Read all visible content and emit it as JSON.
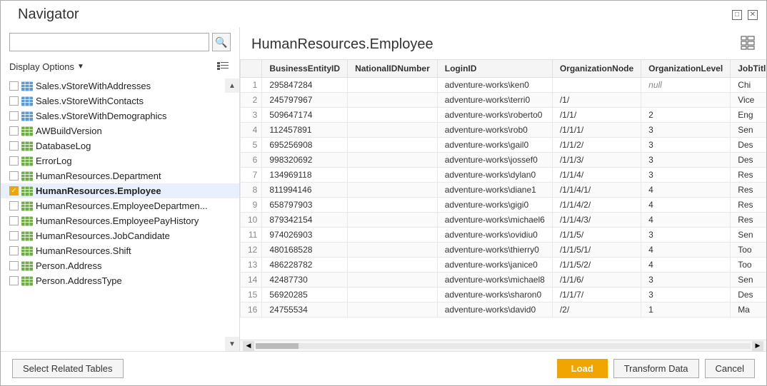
{
  "window": {
    "title": "Navigator"
  },
  "search": {
    "placeholder": "",
    "value": ""
  },
  "display_options": {
    "label": "Display Options",
    "chevron": "▼"
  },
  "nav_items": [
    {
      "id": "salesStoreWithAddresses",
      "label": "Sales.vStoreWithAddresses",
      "checked": false,
      "type": "view"
    },
    {
      "id": "salesStoreWithContacts",
      "label": "Sales.vStoreWithContacts",
      "checked": false,
      "type": "view"
    },
    {
      "id": "salesStoreWithDemographics",
      "label": "Sales.vStoreWithDemographics",
      "checked": false,
      "type": "view"
    },
    {
      "id": "awBuildVersion",
      "label": "AWBuildVersion",
      "checked": false,
      "type": "table"
    },
    {
      "id": "databaseLog",
      "label": "DatabaseLog",
      "checked": false,
      "type": "table"
    },
    {
      "id": "errorLog",
      "label": "ErrorLog",
      "checked": false,
      "type": "table"
    },
    {
      "id": "hrDepartment",
      "label": "HumanResources.Department",
      "checked": false,
      "type": "table"
    },
    {
      "id": "hrEmployee",
      "label": "HumanResources.Employee",
      "checked": true,
      "type": "table",
      "selected": true
    },
    {
      "id": "hrEmployeeDepartment",
      "label": "HumanResources.EmployeeDepartmen...",
      "checked": false,
      "type": "table"
    },
    {
      "id": "hrEmployeePayHistory",
      "label": "HumanResources.EmployeePayHistory",
      "checked": false,
      "type": "table"
    },
    {
      "id": "hrJobCandidate",
      "label": "HumanResources.JobCandidate",
      "checked": false,
      "type": "table"
    },
    {
      "id": "hrShift",
      "label": "HumanResources.Shift",
      "checked": false,
      "type": "table"
    },
    {
      "id": "personAddress",
      "label": "Person.Address",
      "checked": false,
      "type": "table"
    },
    {
      "id": "personAddressType",
      "label": "Person.AddressType",
      "checked": false,
      "type": "table"
    }
  ],
  "preview": {
    "title": "HumanResources.Employee",
    "columns": [
      "BusinessEntityID",
      "NationalIDNumber",
      "LoginID",
      "OrganizationNode",
      "OrganizationLevel",
      "JobTitl"
    ],
    "rows": [
      {
        "num": "1",
        "BusinessEntityID": "295847284",
        "NationalIDNumber": "",
        "LoginID": "adventure-works\\ken0",
        "OrganizationNode": "",
        "OrganizationLevel": "null",
        "JobTitle": "Chi"
      },
      {
        "num": "2",
        "BusinessEntityID": "245797967",
        "NationalIDNumber": "",
        "LoginID": "adventure-works\\terri0",
        "OrganizationNode": "/1/",
        "OrganizationLevel": "",
        "JobTitle": "Vice"
      },
      {
        "num": "3",
        "BusinessEntityID": "509647174",
        "NationalIDNumber": "",
        "LoginID": "adventure-works\\roberto0",
        "OrganizationNode": "/1/1/",
        "OrganizationLevel": "2",
        "JobTitle": "Eng"
      },
      {
        "num": "4",
        "BusinessEntityID": "112457891",
        "NationalIDNumber": "",
        "LoginID": "adventure-works\\rob0",
        "OrganizationNode": "/1/1/1/",
        "OrganizationLevel": "3",
        "JobTitle": "Sen"
      },
      {
        "num": "5",
        "BusinessEntityID": "695256908",
        "NationalIDNumber": "",
        "LoginID": "adventure-works\\gail0",
        "OrganizationNode": "/1/1/2/",
        "OrganizationLevel": "3",
        "JobTitle": "Des"
      },
      {
        "num": "6",
        "BusinessEntityID": "998320692",
        "NationalIDNumber": "",
        "LoginID": "adventure-works\\jossef0",
        "OrganizationNode": "/1/1/3/",
        "OrganizationLevel": "3",
        "JobTitle": "Des"
      },
      {
        "num": "7",
        "BusinessEntityID": "134969118",
        "NationalIDNumber": "",
        "LoginID": "adventure-works\\dylan0",
        "OrganizationNode": "/1/1/4/",
        "OrganizationLevel": "3",
        "JobTitle": "Res"
      },
      {
        "num": "8",
        "BusinessEntityID": "811994146",
        "NationalIDNumber": "",
        "LoginID": "adventure-works\\diane1",
        "OrganizationNode": "/1/1/4/1/",
        "OrganizationLevel": "4",
        "JobTitle": "Res"
      },
      {
        "num": "9",
        "BusinessEntityID": "658797903",
        "NationalIDNumber": "",
        "LoginID": "adventure-works\\gigi0",
        "OrganizationNode": "/1/1/4/2/",
        "OrganizationLevel": "4",
        "JobTitle": "Res"
      },
      {
        "num": "10",
        "BusinessEntityID": "879342154",
        "NationalIDNumber": "",
        "LoginID": "adventure-works\\michael6",
        "OrganizationNode": "/1/1/4/3/",
        "OrganizationLevel": "4",
        "JobTitle": "Res"
      },
      {
        "num": "11",
        "BusinessEntityID": "974026903",
        "NationalIDNumber": "",
        "LoginID": "adventure-works\\ovidiu0",
        "OrganizationNode": "/1/1/5/",
        "OrganizationLevel": "3",
        "JobTitle": "Sen"
      },
      {
        "num": "12",
        "BusinessEntityID": "480168528",
        "NationalIDNumber": "",
        "LoginID": "adventure-works\\thierry0",
        "OrganizationNode": "/1/1/5/1/",
        "OrganizationLevel": "4",
        "JobTitle": "Too"
      },
      {
        "num": "13",
        "BusinessEntityID": "486228782",
        "NationalIDNumber": "",
        "LoginID": "adventure-works\\janice0",
        "OrganizationNode": "/1/1/5/2/",
        "OrganizationLevel": "4",
        "JobTitle": "Too"
      },
      {
        "num": "14",
        "BusinessEntityID": "42487730",
        "NationalIDNumber": "",
        "LoginID": "adventure-works\\michael8",
        "OrganizationNode": "/1/1/6/",
        "OrganizationLevel": "3",
        "JobTitle": "Sen"
      },
      {
        "num": "15",
        "BusinessEntityID": "56920285",
        "NationalIDNumber": "",
        "LoginID": "adventure-works\\sharon0",
        "OrganizationNode": "/1/1/7/",
        "OrganizationLevel": "3",
        "JobTitle": "Des"
      },
      {
        "num": "16",
        "BusinessEntityID": "24755534",
        "NationalIDNumber": "",
        "LoginID": "adventure-works\\david0",
        "OrganizationNode": "/2/",
        "OrganizationLevel": "1",
        "JobTitle": "Ma"
      }
    ]
  },
  "buttons": {
    "select_related": "Select Related Tables",
    "load": "Load",
    "transform": "Transform Data",
    "cancel": "Cancel"
  }
}
